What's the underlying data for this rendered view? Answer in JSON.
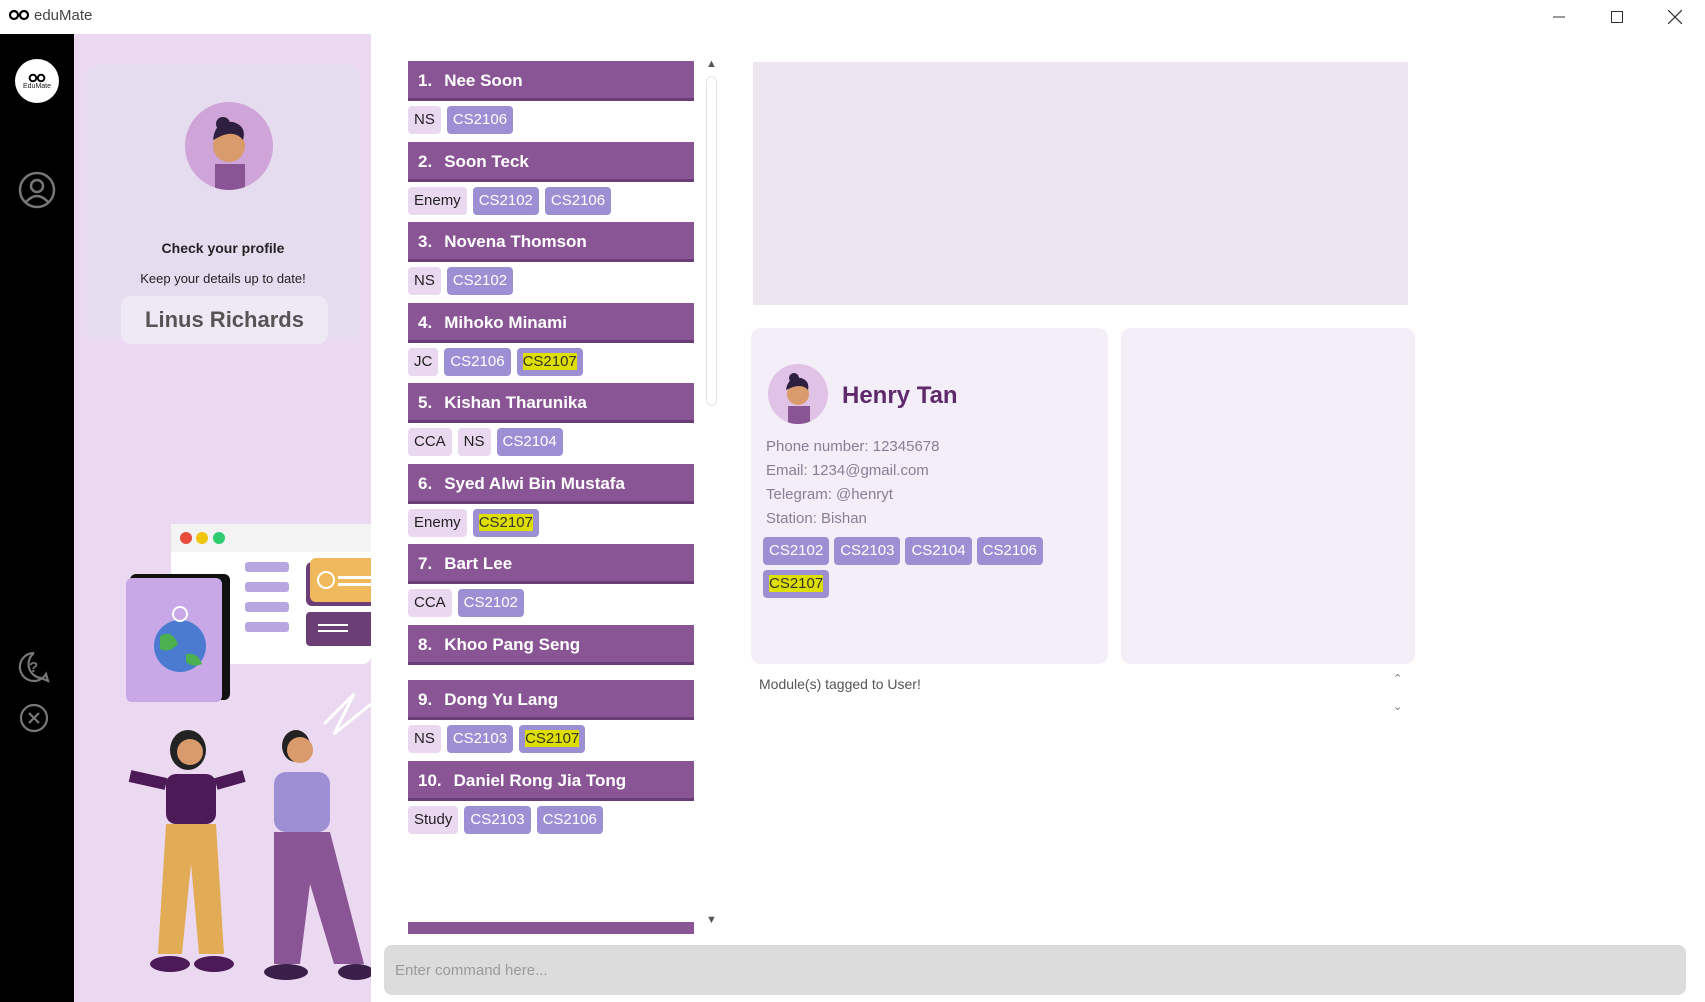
{
  "window": {
    "title": "eduMate",
    "logo_text": "EduMate"
  },
  "profile": {
    "heading": "Check your profile",
    "subtext": "Keep your details up to date!",
    "name": "Linus Richards"
  },
  "persons": [
    {
      "index": "1.",
      "name": "Nee Soon",
      "tags": [
        {
          "label": "NS",
          "kind": "plain"
        },
        {
          "label": "CS2106",
          "kind": "mod"
        }
      ]
    },
    {
      "index": "2.",
      "name": "Soon Teck",
      "tags": [
        {
          "label": "Enemy",
          "kind": "plain"
        },
        {
          "label": "CS2102",
          "kind": "mod"
        },
        {
          "label": "CS2106",
          "kind": "mod"
        }
      ]
    },
    {
      "index": "3.",
      "name": "Novena Thomson",
      "tags": [
        {
          "label": "NS",
          "kind": "plain"
        },
        {
          "label": "CS2102",
          "kind": "mod"
        }
      ]
    },
    {
      "index": "4.",
      "name": "Mihoko Minami",
      "tags": [
        {
          "label": "JC",
          "kind": "plain"
        },
        {
          "label": "CS2106",
          "kind": "mod"
        },
        {
          "label": "CS2107",
          "kind": "hl"
        }
      ]
    },
    {
      "index": "5.",
      "name": "Kishan Tharunika",
      "tags": [
        {
          "label": "CCA",
          "kind": "plain"
        },
        {
          "label": "NS",
          "kind": "plain"
        },
        {
          "label": "CS2104",
          "kind": "mod"
        }
      ]
    },
    {
      "index": "6.",
      "name": "Syed Alwi Bin Mustafa",
      "tags": [
        {
          "label": "Enemy",
          "kind": "plain"
        },
        {
          "label": "CS2107",
          "kind": "hl"
        }
      ]
    },
    {
      "index": "7.",
      "name": "Bart Lee",
      "tags": [
        {
          "label": "CCA",
          "kind": "plain"
        },
        {
          "label": "CS2102",
          "kind": "mod"
        }
      ]
    },
    {
      "index": "8.",
      "name": "Khoo Pang Seng",
      "tags": []
    },
    {
      "index": "9.",
      "name": "Dong Yu Lang",
      "tags": [
        {
          "label": "NS",
          "kind": "plain"
        },
        {
          "label": "CS2103",
          "kind": "mod"
        },
        {
          "label": "CS2107",
          "kind": "hl"
        }
      ]
    },
    {
      "index": "10.",
      "name": "Daniel Rong Jia Tong",
      "tags": [
        {
          "label": "Study",
          "kind": "plain"
        },
        {
          "label": "CS2103",
          "kind": "mod"
        },
        {
          "label": "CS2106",
          "kind": "mod"
        }
      ]
    }
  ],
  "selected_contact": {
    "name": "Henry Tan",
    "phone": "Phone number: 12345678",
    "email": "Email: 1234@gmail.com",
    "telegram": "Telegram: @henryt",
    "station": "Station: Bishan",
    "modules": [
      {
        "label": "CS2102",
        "kind": "mod"
      },
      {
        "label": "CS2103",
        "kind": "mod"
      },
      {
        "label": "CS2104",
        "kind": "mod"
      },
      {
        "label": "CS2106",
        "kind": "mod"
      },
      {
        "label": "CS2107",
        "kind": "hl"
      }
    ]
  },
  "modules_label": "Module(s) tagged to User!",
  "command": {
    "placeholder": "Enter command here..."
  },
  "colors": {
    "header": "#8a5595",
    "module_tag": "#9d8fd4",
    "plain_tag": "#e9d8f0",
    "highlight": "#dede00",
    "sidebar": "#000000",
    "profile_bg": "#ead9f0"
  }
}
